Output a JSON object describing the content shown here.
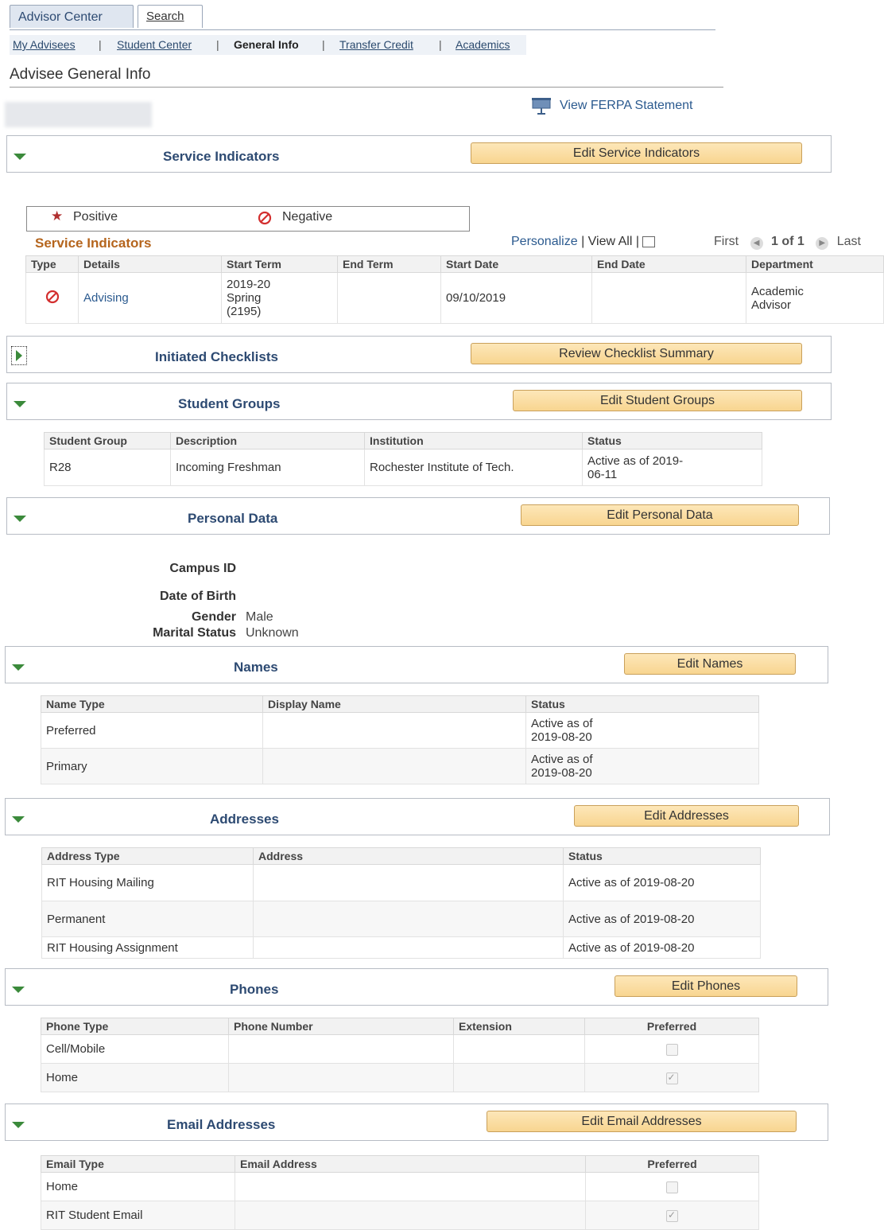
{
  "tabs": {
    "advisor_center": "Advisor Center",
    "search": "Search"
  },
  "subnav": {
    "my_advisees": "My Advisees",
    "sep": "|",
    "student_center": "Student Center",
    "general_info": "General Info",
    "transfer_credit": "Transfer Credit",
    "academics": "Academics"
  },
  "page_title": "Advisee General Info",
  "ferpa_link": "View FERPA Statement",
  "service_indicators": {
    "title": "Service Indicators",
    "button": "Edit Service Indicators",
    "legend_positive": "Positive",
    "legend_negative": "Negative",
    "grid_title": "Service Indicators",
    "personalize": "Personalize",
    "view_all": "View All",
    "nav_sep": "|",
    "first": "First",
    "pager": "1 of 1",
    "last": "Last",
    "columns": [
      "Type",
      "Details",
      "Start Term",
      "End Term",
      "Start Date",
      "End Date",
      "Department"
    ],
    "rows": [
      {
        "details": "Advising",
        "start_term": "2019-20\nSpring\n(2195)",
        "end_term": "",
        "start_date": "09/10/2019",
        "end_date": "",
        "department": "Academic\nAdvisor"
      }
    ]
  },
  "checklists": {
    "title": "Initiated Checklists",
    "button": "Review Checklist Summary"
  },
  "student_groups": {
    "title": "Student Groups",
    "button": "Edit Student Groups",
    "columns": [
      "Student Group",
      "Description",
      "Institution",
      "Status"
    ],
    "rows": [
      {
        "group": "R28",
        "description": "Incoming Freshman",
        "institution": "Rochester Institute of Tech.",
        "status": "Active as of 2019-\n06-11"
      }
    ]
  },
  "personal_data": {
    "title": "Personal Data",
    "button": "Edit Personal Data",
    "campus_id_label": "Campus ID",
    "dob_label": "Date of Birth",
    "gender_label": "Gender",
    "gender_value": "Male",
    "marital_label": "Marital Status",
    "marital_value": "Unknown"
  },
  "names": {
    "title": "Names",
    "button": "Edit Names",
    "columns": [
      "Name Type",
      "Display Name",
      "Status"
    ],
    "rows": [
      {
        "type": "Preferred",
        "display": "",
        "status": "Active as of\n2019-08-20"
      },
      {
        "type": "Primary",
        "display": "",
        "status": "Active as of\n2019-08-20"
      }
    ]
  },
  "addresses": {
    "title": "Addresses",
    "button": "Edit Addresses",
    "columns": [
      "Address Type",
      "Address",
      "Status"
    ],
    "rows": [
      {
        "type": "RIT Housing Mailing",
        "address": "",
        "status": "Active as of 2019-08-20"
      },
      {
        "type": "Permanent",
        "address": "",
        "status": "Active as of 2019-08-20"
      },
      {
        "type": "RIT Housing Assignment",
        "address": "",
        "status": "Active as of 2019-08-20"
      }
    ]
  },
  "phones": {
    "title": "Phones",
    "button": "Edit Phones",
    "columns": [
      "Phone Type",
      "Phone Number",
      "Extension",
      "Preferred"
    ],
    "rows": [
      {
        "type": "Cell/Mobile",
        "number": "",
        "extension": "",
        "preferred": false
      },
      {
        "type": "Home",
        "number": "",
        "extension": "",
        "preferred": true
      }
    ]
  },
  "emails": {
    "title": "Email Addresses",
    "button": "Edit Email Addresses",
    "columns": [
      "Email Type",
      "Email Address",
      "Preferred"
    ],
    "rows": [
      {
        "type": "Home",
        "address": "",
        "preferred": false
      },
      {
        "type": "RIT Student Email",
        "address": "",
        "preferred": true
      }
    ]
  },
  "colors": {
    "section_title": "#2d4a72",
    "button_fill": "#f8d590",
    "grid_title": "#b5651d",
    "negative_icon": "#d32f2f",
    "positive_icon": "#b03030"
  }
}
